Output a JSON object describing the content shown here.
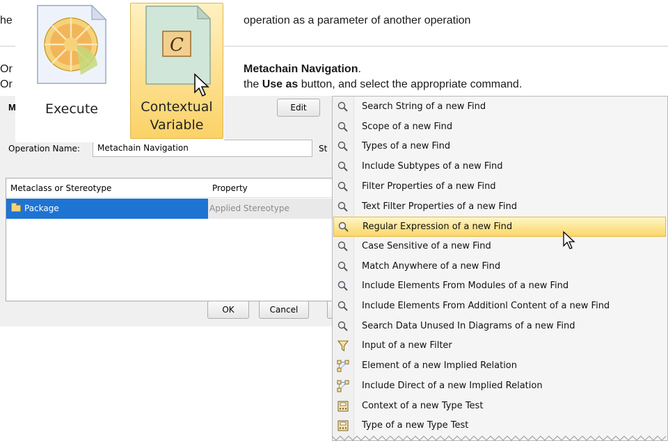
{
  "document": {
    "line1_prefix": "he",
    "line1_suffix": "operation as a parameter of another operation",
    "line2_prefix": "Or",
    "line2_bold": "Metachain Navigation",
    "line2_tail": ".",
    "line3_prefix": "Or",
    "line3_mid": "the ",
    "line3_bold": "Use as",
    "line3_tail": " button, and select the appropriate command."
  },
  "toolbar": {
    "execute_label": "Execute",
    "contextual_label_line1": "Contextual",
    "contextual_label_line2": "Variable",
    "contextual_glyph": "C"
  },
  "dialog": {
    "title": "M",
    "edit_button": "Edit",
    "operation_name_label": "Operation Name:",
    "operation_name_value": "Metachain Navigation",
    "truncated_label": "St",
    "table": {
      "headers": [
        "Metaclass or Stereotype",
        "Property"
      ],
      "rows": [
        {
          "metaclass": "Package",
          "property": "Applied Stereotype"
        }
      ]
    },
    "ok_button": "OK",
    "cancel_button": "Cancel"
  },
  "menu": {
    "items": [
      {
        "label": "Search String of a new Find",
        "icon": "magnifier-icon"
      },
      {
        "label": "Scope of a new Find",
        "icon": "magnifier-icon"
      },
      {
        "label": "Types of a new Find",
        "icon": "magnifier-icon"
      },
      {
        "label": "Include Subtypes of a new Find",
        "icon": "magnifier-icon"
      },
      {
        "label": "Filter Properties of a new Find",
        "icon": "magnifier-icon"
      },
      {
        "label": "Text Filter Properties of a new Find",
        "icon": "magnifier-icon"
      },
      {
        "label": "Regular Expression of a new Find",
        "icon": "magnifier-icon",
        "highlighted": true
      },
      {
        "label": "Case Sensitive of a new Find",
        "icon": "magnifier-icon"
      },
      {
        "label": "Match Anywhere of a new Find",
        "icon": "magnifier-icon"
      },
      {
        "label": "Include Elements From Modules of a new Find",
        "icon": "magnifier-icon"
      },
      {
        "label": "Include Elements From Additionl Content of a new Find",
        "icon": "magnifier-icon"
      },
      {
        "label": "Search Data Unused In Diagrams of a new Find",
        "icon": "magnifier-icon"
      },
      {
        "label": "Input of a new Filter",
        "icon": "funnel-icon"
      },
      {
        "label": "Element of a new Implied Relation",
        "icon": "relation-icon"
      },
      {
        "label": "Include Direct of a new Implied Relation",
        "icon": "relation-icon"
      },
      {
        "label": "Context of a new Type Test",
        "icon": "type-test-icon"
      },
      {
        "label": "Type of a new Type Test",
        "icon": "type-test-icon"
      }
    ]
  },
  "colors": {
    "selection_blue": "#1e74d2",
    "highlight_yellow": "#fbd66a",
    "toolbar_active": "#fbd267"
  }
}
